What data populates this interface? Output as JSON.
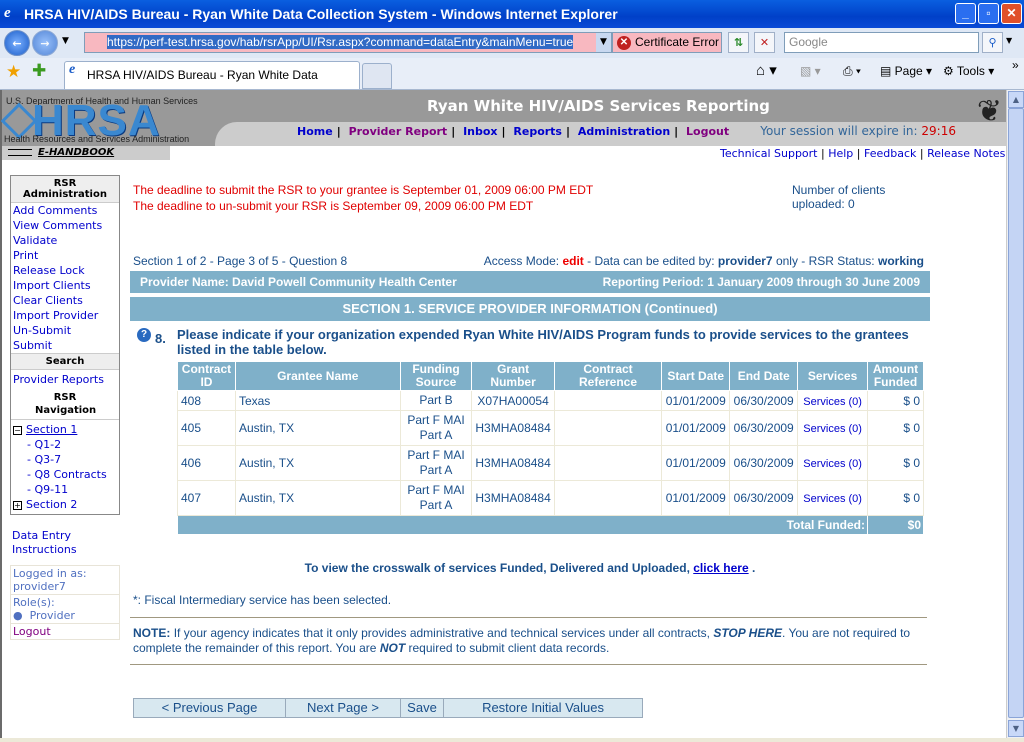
{
  "browser": {
    "window_title": "HRSA HIV/AIDS Bureau - Ryan White Data Collection System - Windows Internet Explorer",
    "url": "https://perf-test.hrsa.gov/hab/rsrApp/UI/Rsr.aspx?command=dataEntry&mainMenu=true",
    "cert_error": "Certificate Error",
    "search_placeholder": "Google",
    "tab_title": "HRSA HIV/AIDS Bureau - Ryan White Data Collection ...",
    "page_menu": "Page",
    "tools_menu": "Tools"
  },
  "header": {
    "dept": "U.S. Department of Health and Human Services",
    "logo": "HRSA",
    "agency": "Health Resources and Services Administration",
    "handbook": "E-HANDBOOK",
    "app_title": "Ryan White HIV/AIDS Services Reporting",
    "nav": [
      "Home",
      "Provider Report",
      "Inbox",
      "Reports",
      "Administration",
      "Logout"
    ],
    "session_label": "Your session will expire in:",
    "session_time": "29:16",
    "links": [
      "Technical Support",
      "Help",
      "Feedback",
      "Release Notes"
    ]
  },
  "sidebar": {
    "admin_title": "RSR Administration",
    "admin_items": [
      "Add Comments",
      "View Comments",
      "Validate",
      "Print",
      "Release Lock",
      "Import Clients",
      "Clear Clients",
      "Import Provider",
      "Un-Submit",
      "Submit"
    ],
    "search_title": "Search",
    "search_items": [
      "Provider Reports"
    ],
    "nav_title": "RSR Navigation",
    "section1": "Section 1",
    "section1_items": [
      "- Q1-2",
      "- Q3-7",
      "- Q8 Contracts",
      "- Q9-11"
    ],
    "section2": "Section 2",
    "instructions": "Data Entry Instructions",
    "logged_in_label": "Logged in as:",
    "user": "provider7",
    "roles_label": "Role(s):",
    "role": "Provider",
    "logout": "Logout"
  },
  "main": {
    "deadline1": "The deadline to submit the RSR to your grantee is September 01, 2009 06:00 PM EDT",
    "deadline2": "The deadline to un-submit your RSR is September 09, 2009 06:00 PM EDT",
    "clients_uploaded": "Number of clients uploaded: 0",
    "position": "Section 1 of 2 - Page 3 of 5 - Question 8",
    "access_label": "Access Mode:",
    "access_mode": "edit",
    "edit_label": "- Data can be edited by:",
    "editor": "provider7",
    "status_label": "only - RSR Status:",
    "status": "working",
    "provider_name": "Provider Name: David Powell Community Health Center",
    "reporting_period": "Reporting Period: 1 January 2009 through 30 June 2009",
    "section_title": "SECTION 1. SERVICE PROVIDER INFORMATION (Continued)",
    "q_num": "8.",
    "question": "Please indicate if your organization expended Ryan White HIV/AIDS Program funds to provide services to the grantees listed in the table below.",
    "columns": [
      "Contract ID",
      "Grantee Name",
      "Funding Source",
      "Grant Number",
      "Contract Reference",
      "Start Date",
      "End Date",
      "Services",
      "Amount Funded"
    ],
    "rows": [
      {
        "id": "408",
        "grantee": "Texas",
        "source1": "Part B",
        "source2": "",
        "grant": "X07HA00054",
        "ref": "",
        "start": "01/01/2009",
        "end": "06/30/2009",
        "services": "Services (0)",
        "amount": "$ 0"
      },
      {
        "id": "405",
        "grantee": "Austin, TX",
        "source1": "Part F MAI",
        "source2": "Part A",
        "grant": "H3MHA08484",
        "ref": "",
        "start": "01/01/2009",
        "end": "06/30/2009",
        "services": "Services (0)",
        "amount": "$ 0"
      },
      {
        "id": "406",
        "grantee": "Austin, TX",
        "source1": "Part F MAI",
        "source2": "Part A",
        "grant": "H3MHA08484",
        "ref": "",
        "start": "01/01/2009",
        "end": "06/30/2009",
        "services": "Services (0)",
        "amount": "$ 0"
      },
      {
        "id": "407",
        "grantee": "Austin, TX",
        "source1": "Part F MAI",
        "source2": "Part A",
        "grant": "H3MHA08484",
        "ref": "",
        "start": "01/01/2009",
        "end": "06/30/2009",
        "services": "Services (0)",
        "amount": "$ 0"
      }
    ],
    "total_label": "Total Funded:",
    "total": "$0",
    "crosswalk_text": "To view the crosswalk of services Funded, Delivered and Uploaded,",
    "crosswalk_link": "click here",
    "crosswalk_end": ".",
    "fiscal_note": "*: Fiscal Intermediary service has been selected.",
    "note_label": "NOTE:",
    "note1": "If your agency indicates that it only provides administrative and technical services under all contracts,",
    "note_stop": "STOP HERE",
    "note2": ". You are not required to complete the remainder of this report. You are",
    "note_not": "NOT",
    "note3": "required to submit client data records.",
    "buttons": [
      "< Previous Page",
      "Next Page >",
      "Save",
      "Restore Initial Values"
    ]
  }
}
